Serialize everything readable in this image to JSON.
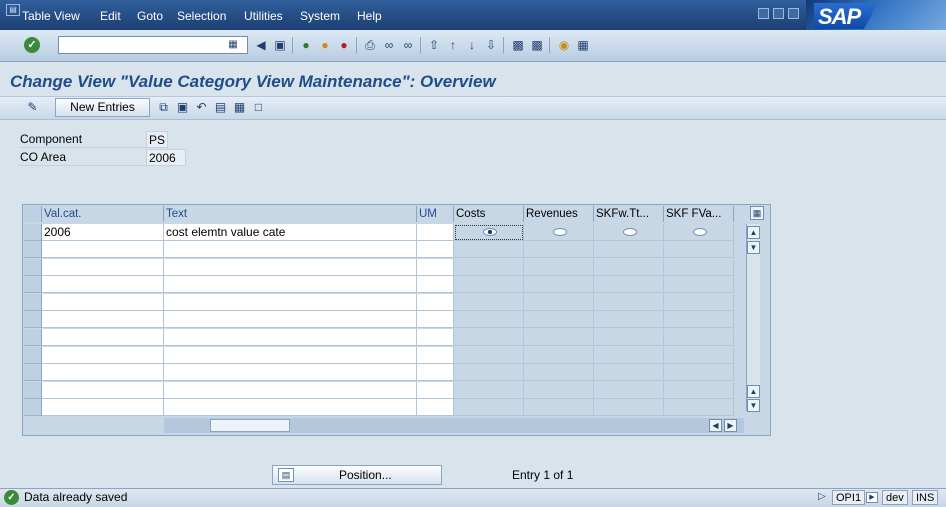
{
  "menu": [
    {
      "label": "Table View"
    },
    {
      "label": "Edit"
    },
    {
      "label": "Goto"
    },
    {
      "label": "Selection"
    },
    {
      "label": "Utilities"
    },
    {
      "label": "System"
    },
    {
      "label": "Help"
    }
  ],
  "brand": {
    "logo": "SAP"
  },
  "command_field": {
    "value": ""
  },
  "title": "Change View \"Value Category View Maintenance\": Overview",
  "app_toolbar": {
    "new_entries": "New Entries"
  },
  "header": {
    "component": {
      "label": "Component",
      "value": "PS"
    },
    "co_area": {
      "label": "CO Area",
      "value": "2006"
    }
  },
  "table": {
    "columns": [
      "Val.cat.",
      "Text",
      "UM",
      "Costs",
      "Revenues",
      "SKFw.Tt...",
      "SKF FVa..."
    ],
    "rows": [
      {
        "val_cat": "2006",
        "text": "cost elemtn value cate",
        "um": "",
        "selected": "Costs"
      }
    ],
    "empty_rows": 10
  },
  "position_button": {
    "label": "Position..."
  },
  "entry_info": "Entry 1 of 1",
  "status": {
    "message": "Data already saved",
    "system": "OPI1",
    "client": "dev",
    "mode": "INS"
  },
  "colors": {
    "title": "#1f4d8a",
    "menubar": "#1d3f72",
    "background": "#d9e3ec",
    "ok_green": "#3a8a3a"
  }
}
